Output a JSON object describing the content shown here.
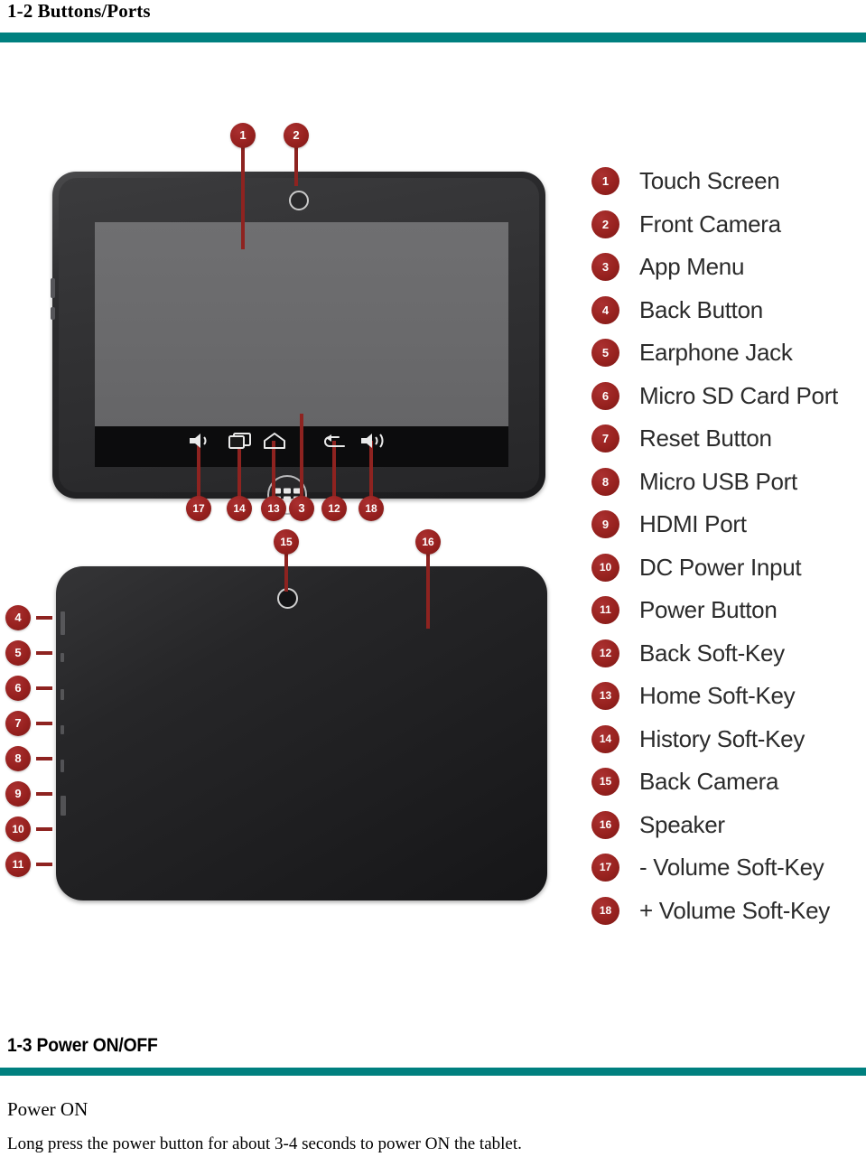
{
  "sections": {
    "buttons_ports": {
      "heading": "1-2 Buttons/Ports"
    },
    "power_onoff": {
      "heading": "1-3 Power ON/OFF",
      "subheading": "Power ON",
      "body": "Long press the power button for about 3-4 seconds to power ON the tablet."
    }
  },
  "colors": {
    "rule": "#00807F",
    "badge": "#97211F",
    "leader": "#8E2320",
    "device_body": "#232325",
    "screen": "#6A6A6C"
  },
  "legend": {
    "items": [
      {
        "number": "1",
        "label": "Touch Screen"
      },
      {
        "number": "2",
        "label": "Front Camera"
      },
      {
        "number": "3",
        "label": "App Menu"
      },
      {
        "number": "4",
        "label": "Back Button"
      },
      {
        "number": "5",
        "label": "Earphone Jack"
      },
      {
        "number": "6",
        "label": "Micro SD Card Port"
      },
      {
        "number": "7",
        "label": "Reset Button"
      },
      {
        "number": "8",
        "label": "Micro USB Port"
      },
      {
        "number": "9",
        "label": "HDMI Port"
      },
      {
        "number": "10",
        "label": "DC Power Input"
      },
      {
        "number": "11",
        "label": "Power Button"
      },
      {
        "number": "12",
        "label": "Back Soft-Key"
      },
      {
        "number": "13",
        "label": "Home Soft-Key"
      },
      {
        "number": "14",
        "label": "History Soft-Key"
      },
      {
        "number": "15",
        "label": "Back Camera"
      },
      {
        "number": "16",
        "label": "Speaker"
      },
      {
        "number": "17",
        "label": "- Volume Soft-Key"
      },
      {
        "number": "18",
        "label": "+ Volume Soft-Key"
      }
    ]
  },
  "diagram": {
    "front_callouts": [
      {
        "number": "1",
        "target": "touch-screen"
      },
      {
        "number": "2",
        "target": "front-camera"
      },
      {
        "number": "17",
        "target": "volume-down-soft-key"
      },
      {
        "number": "14",
        "target": "history-soft-key"
      },
      {
        "number": "13",
        "target": "home-soft-key"
      },
      {
        "number": "3",
        "target": "app-menu"
      },
      {
        "number": "12",
        "target": "back-soft-key"
      },
      {
        "number": "18",
        "target": "volume-up-soft-key"
      }
    ],
    "back_callouts": [
      {
        "number": "4",
        "target": "back-button"
      },
      {
        "number": "5",
        "target": "earphone-jack"
      },
      {
        "number": "6",
        "target": "micro-sd-card-port"
      },
      {
        "number": "7",
        "target": "reset-button"
      },
      {
        "number": "8",
        "target": "micro-usb-port"
      },
      {
        "number": "9",
        "target": "hdmi-port"
      },
      {
        "number": "10",
        "target": "dc-power-input"
      },
      {
        "number": "11",
        "target": "power-button"
      },
      {
        "number": "15",
        "target": "back-camera"
      },
      {
        "number": "16",
        "target": "speaker"
      }
    ],
    "navbar_icons": [
      "volume-down-icon",
      "recents-icon",
      "home-icon",
      "back-icon",
      "volume-up-icon"
    ]
  }
}
